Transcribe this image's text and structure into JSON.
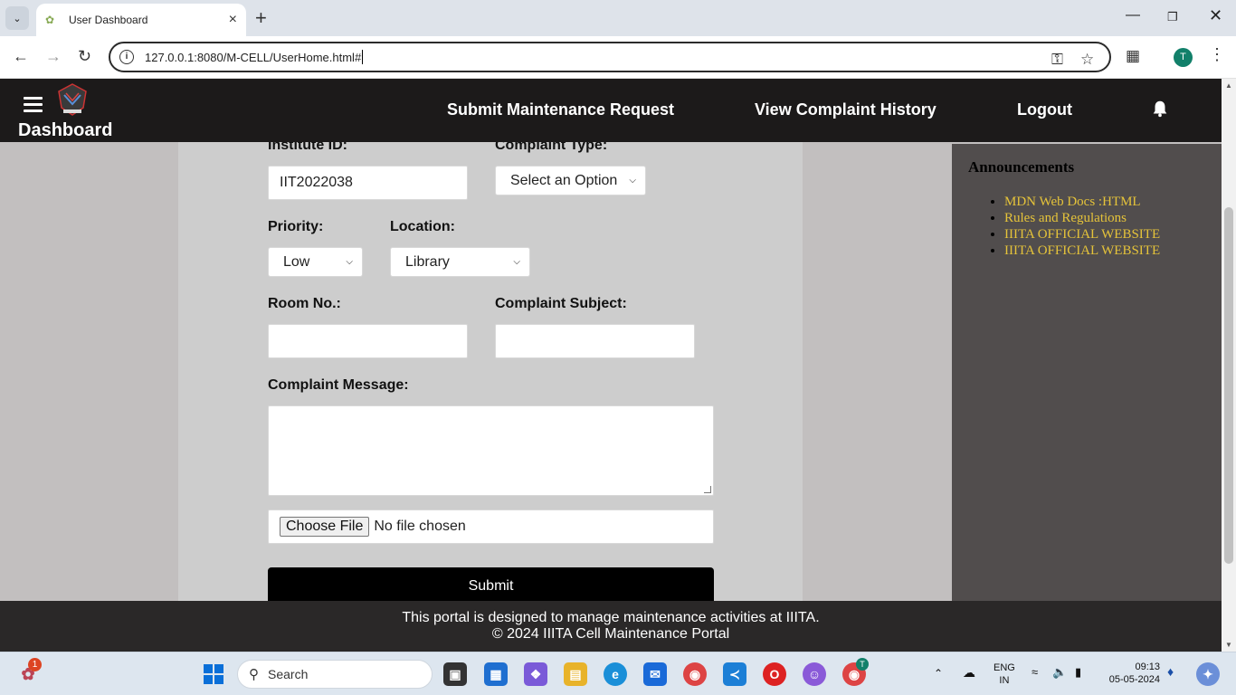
{
  "browser": {
    "tab_title": "User Dashboard",
    "url": "127.0.0.1:8080/M-CELL/UserHome.html#",
    "profile_initial": "T"
  },
  "header": {
    "brand": "Dashboard",
    "nav": {
      "submit_request": "Submit Maintenance Request",
      "history": "View Complaint History",
      "logout": "Logout"
    }
  },
  "form": {
    "institute_id_label": "Institute ID:",
    "institute_id_value": "IIT2022038",
    "complaint_type_label": "Complaint Type:",
    "complaint_type_value": "Select an Option",
    "priority_label": "Priority:",
    "priority_value": "Low",
    "location_label": "Location:",
    "location_value": "Library",
    "room_label": "Room No.:",
    "room_value": "",
    "subject_label": "Complaint Subject:",
    "subject_value": "",
    "message_label": "Complaint Message:",
    "message_value": "",
    "file_button": "Choose File",
    "file_status": "No file chosen",
    "submit_label": "Submit"
  },
  "announcements": {
    "title": "Announcements",
    "items": [
      "MDN Web Docs :HTML",
      "Rules and Regulations",
      "IIITA OFFICIAL WEBSITE",
      "IIITA OFFICIAL WEBSITE"
    ]
  },
  "footer": {
    "line1": "This portal is designed to manage maintenance activities at IIITA.",
    "line2": "© 2024 IIITA Cell Maintenance Portal"
  },
  "taskbar": {
    "notification_count": "1",
    "search_placeholder": "Search",
    "lang_line1": "ENG",
    "lang_line2": "IN",
    "time": "09:13",
    "date": "05-05-2024",
    "chrome_profile_initial": "T"
  },
  "colors": {
    "header_bg": "#1c1a1a",
    "announcement_link": "#e5c33a",
    "submit_bg": "#000000"
  }
}
